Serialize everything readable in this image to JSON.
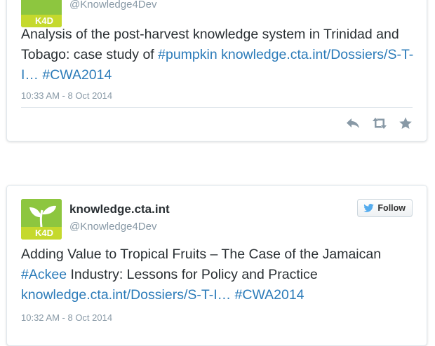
{
  "tweets": [
    {
      "handle": "@Knowledge4Dev",
      "text_segments": [
        {
          "text": "Analysis of the post-harvest knowledge system in Trinidad and Tobago: case study of ",
          "type": "plain"
        },
        {
          "text": "#pumpkin",
          "type": "link"
        },
        {
          "text": " ",
          "type": "plain"
        },
        {
          "text": "knowledge.cta.int/Dossiers/S-T-I…",
          "type": "link"
        },
        {
          "text": " ",
          "type": "plain"
        },
        {
          "text": "#CWA2014",
          "type": "link"
        }
      ],
      "timestamp": "10:33 AM - 8 Oct 2014",
      "actions": [
        "reply-icon",
        "retweet-icon",
        "favorite-icon"
      ]
    },
    {
      "display_name": "knowledge.cta.int",
      "handle": "@Knowledge4Dev",
      "follow_label": "Follow",
      "text_segments": [
        {
          "text": "Adding Value to Tropical Fruits – The Case of the Jamaican ",
          "type": "plain"
        },
        {
          "text": "#Ackee",
          "type": "link"
        },
        {
          "text": " Industry: Lessons for Policy and Practice ",
          "type": "plain"
        },
        {
          "text": "knowledge.cta.int/Dossiers/S-T-I…",
          "type": "link"
        },
        {
          "text": " ",
          "type": "plain"
        },
        {
          "text": "#CWA2014",
          "type": "link"
        }
      ],
      "timestamp": "10:32 AM - 8 Oct 2014"
    }
  ],
  "avatar_logo_text": "K4D",
  "colors": {
    "link": "#2b7bb9",
    "avatar_green": "#8dc63f",
    "muted": "#8899a6",
    "twitter_blue": "#55acee"
  }
}
